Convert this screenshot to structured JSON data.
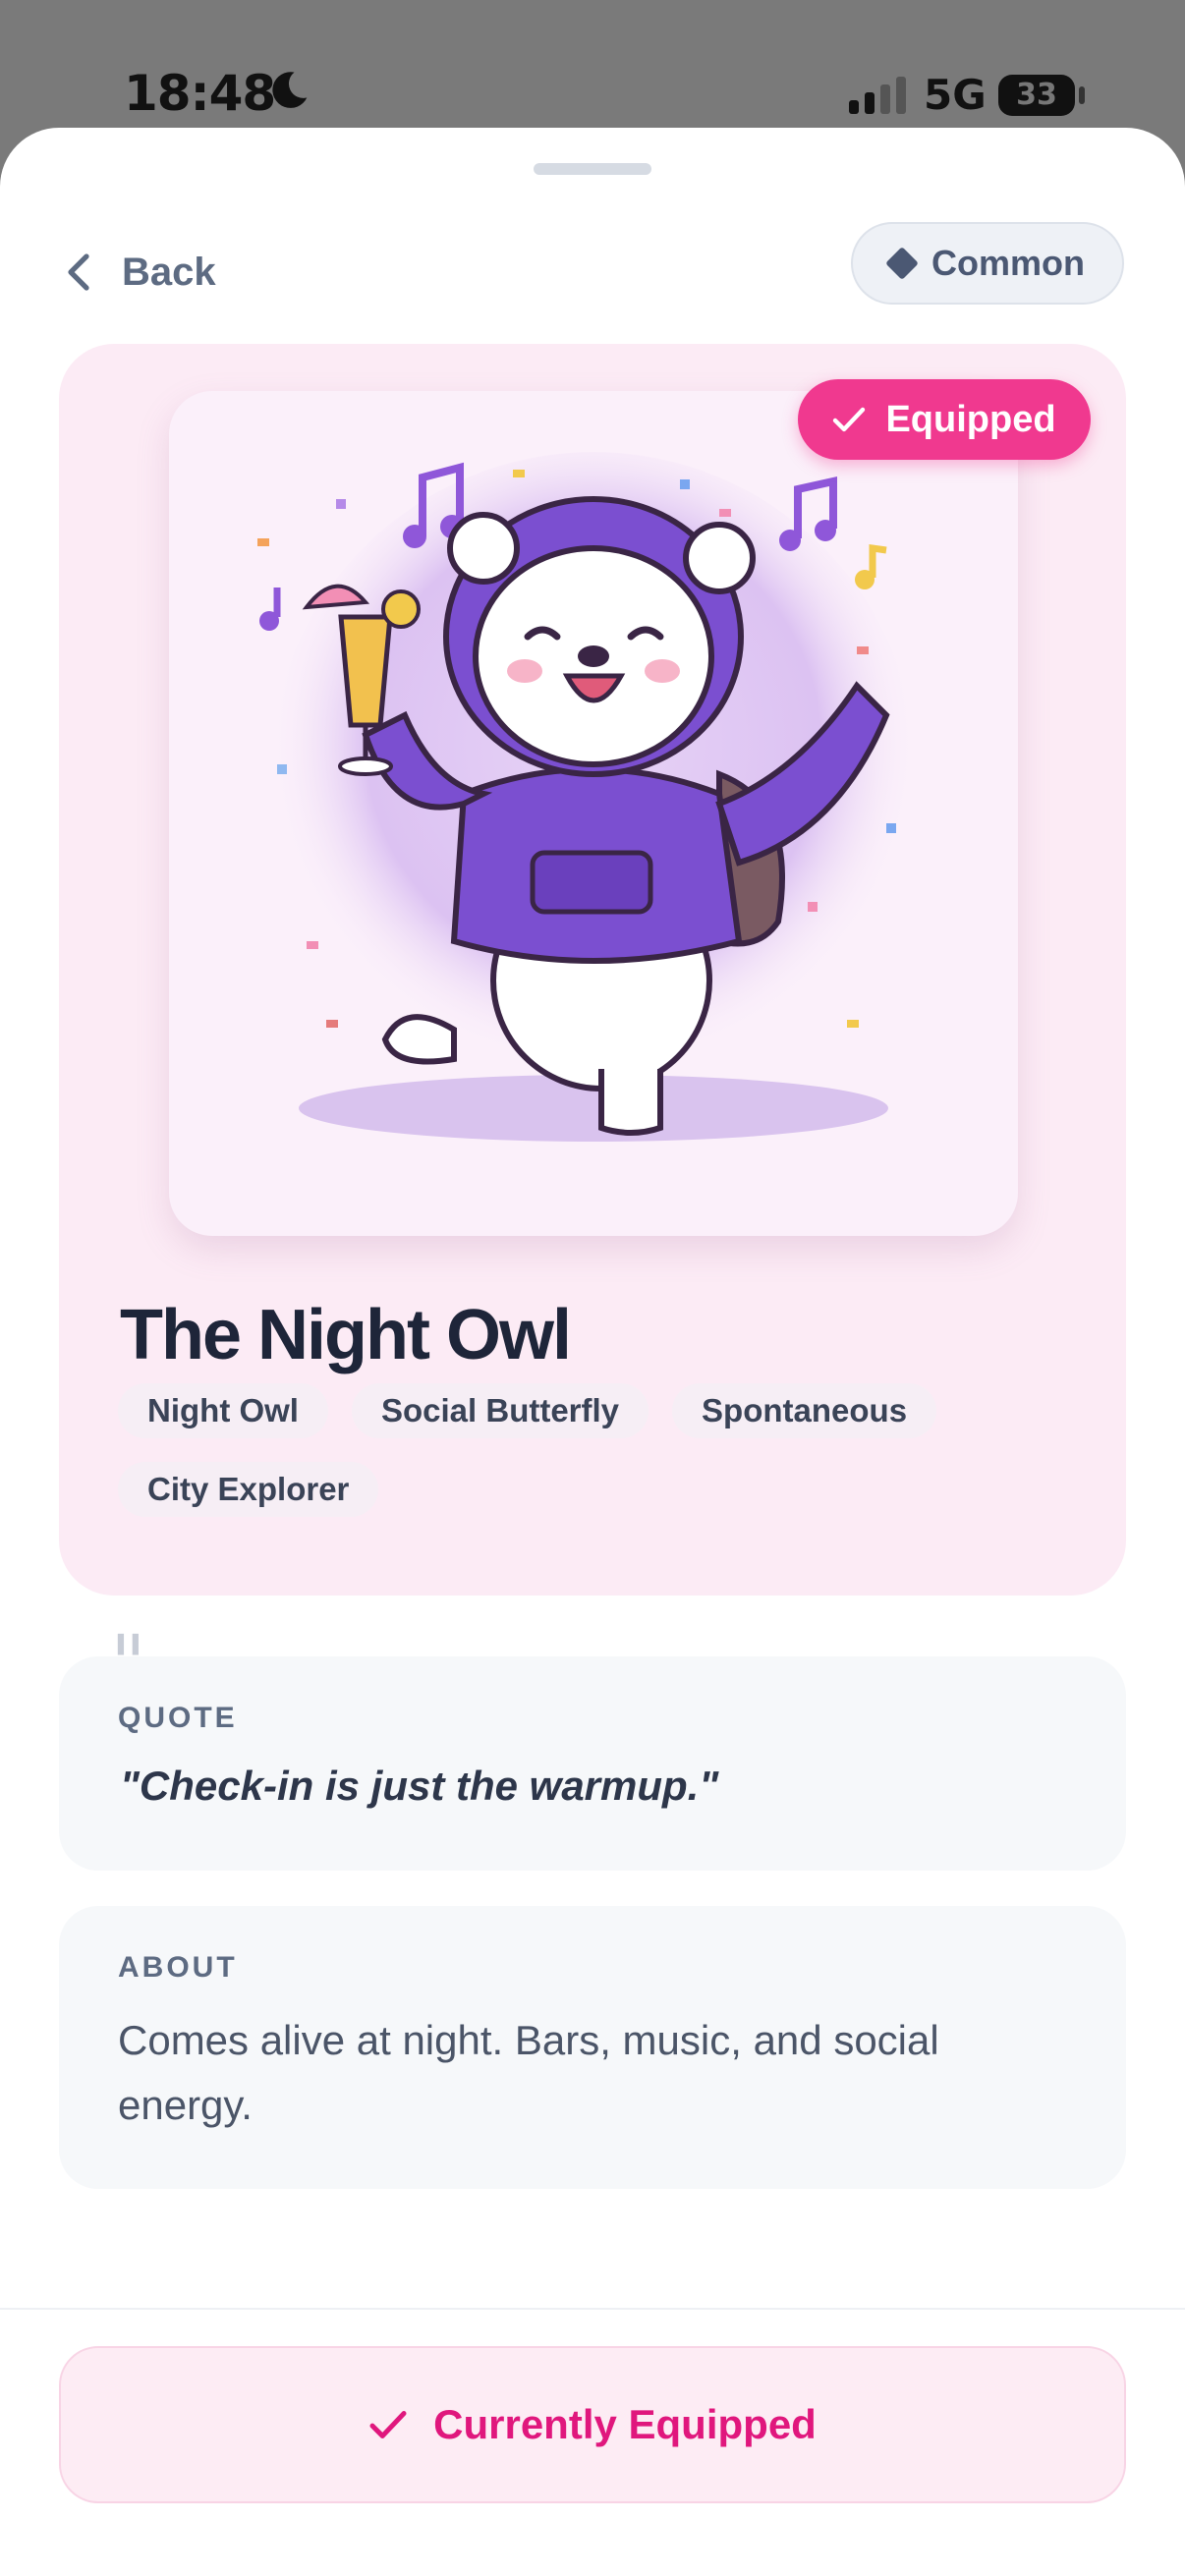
{
  "status_bar": {
    "time": "18:48",
    "network": "5G",
    "battery": "33"
  },
  "header": {
    "back_label": "Back",
    "rarity_label": "Common"
  },
  "card": {
    "badge_label": "Equipped",
    "title": "The Night Owl",
    "tags": [
      "Night Owl",
      "Social Butterfly",
      "Spontaneous",
      "City Explorer"
    ]
  },
  "quote": {
    "label": "QUOTE",
    "text": "\"Check-in is just the warmup.\""
  },
  "about": {
    "label": "ABOUT",
    "text": "Comes alive at night. Bars, music, and social energy."
  },
  "footer": {
    "cta_label": "Currently Equipped"
  },
  "colors": {
    "accent_pink": "#f0398f",
    "cta_text": "#e0177d",
    "hoodie": "#7b4fd0"
  }
}
